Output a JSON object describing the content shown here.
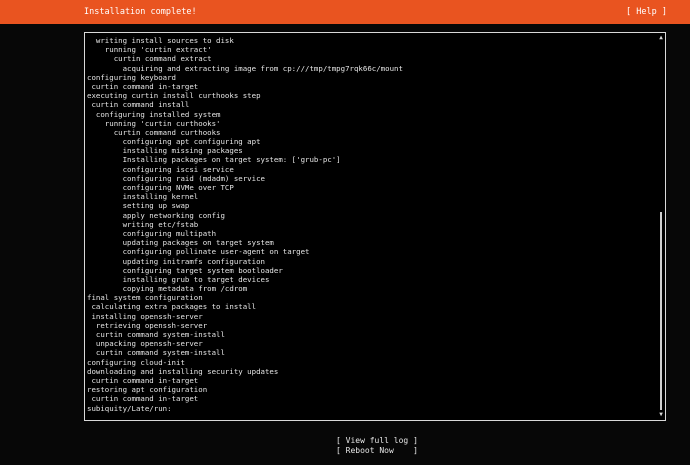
{
  "header": {
    "title": "Installation complete!",
    "help_label": "[ Help ]"
  },
  "log": {
    "lines": [
      "  writing install sources to disk",
      "    running 'curtin extract'",
      "      curtin command extract",
      "        acquiring and extracting image from cp:///tmp/tmpg7rqk66c/mount",
      "configuring keyboard",
      " curtin command in-target",
      "executing curtin install curthooks step",
      " curtin command install",
      "  configuring installed system",
      "    running 'curtin curthooks'",
      "      curtin command curthooks",
      "        configuring apt configuring apt",
      "        installing missing packages",
      "        Installing packages on target system: ['grub-pc']",
      "        configuring iscsi service",
      "        configuring raid (mdadm) service",
      "        configuring NVMe over TCP",
      "        installing kernel",
      "        setting up swap",
      "        apply networking config",
      "        writing etc/fstab",
      "        configuring multipath",
      "        updating packages on target system",
      "        configuring pollinate user-agent on target",
      "        updating initramfs configuration",
      "        configuring target system bootloader",
      "        installing grub to target devices",
      "        copying metadata from /cdrom",
      "final system configuration",
      " calculating extra packages to install",
      " installing openssh-server",
      "  retrieving openssh-server",
      "  curtin command system-install",
      "  unpacking openssh-server",
      "  curtin command system-install",
      "configuring cloud-init",
      "downloading and installing security updates",
      " curtin command in-target",
      "restoring apt configuration",
      " curtin command in-target",
      "subiquity/Late/run:"
    ],
    "scroll_position": 0.46,
    "scroll_visible_fraction": 0.54
  },
  "actions": {
    "view_log_label": "[ View full log ]",
    "reboot_label": "[ Reboot Now    ]"
  },
  "colors": {
    "accent": "#e95420",
    "background": "#070707",
    "text": "#e6e6e6"
  }
}
